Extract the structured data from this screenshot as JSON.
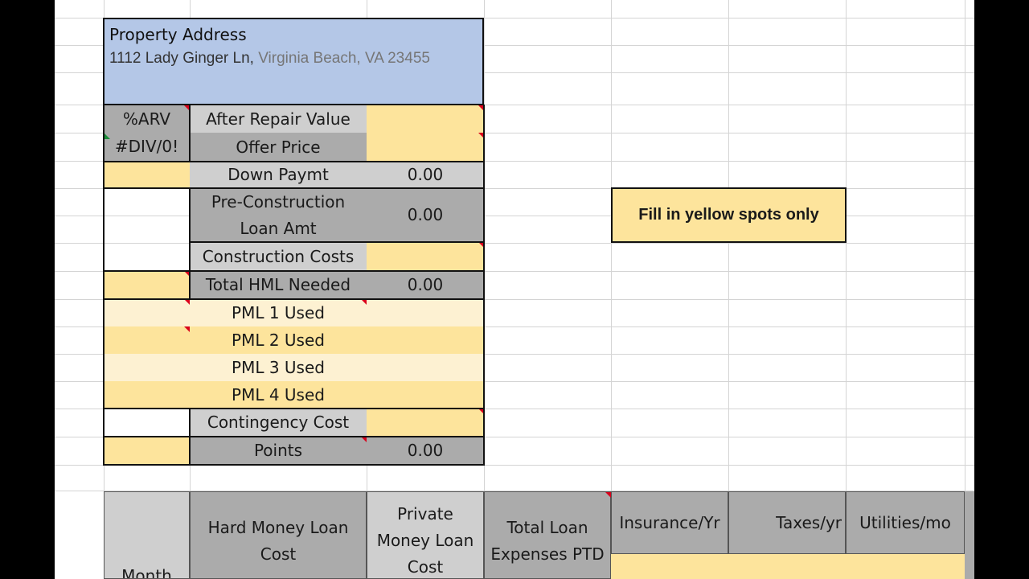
{
  "property": {
    "heading": "Property Address",
    "street": "1112 Lady Ginger Ln,",
    "city": "Virginia Beach, VA 23455"
  },
  "arv": {
    "label": "%ARV",
    "value": "#DIV/0!"
  },
  "rows": {
    "after_repair_value": "After Repair Value",
    "offer_price": "Offer Price",
    "down_paymt": {
      "label": "Down Paymt",
      "value": "0.00"
    },
    "pre_construction": {
      "line1": "Pre-Construction",
      "line2": "Loan Amt",
      "value": "0.00"
    },
    "construction_costs": "Construction Costs",
    "total_hml": {
      "label": "Total HML Needed",
      "value": "0.00"
    },
    "pml1": "PML 1 Used",
    "pml2": "PML 2 Used",
    "pml3": "PML 3 Used",
    "pml4": "PML 4 Used",
    "contingency": "Contingency Cost",
    "points": {
      "label": "Points",
      "value": "0.00"
    }
  },
  "note": "Fill in yellow spots only",
  "table_headers": {
    "month": "Month",
    "hml_line1": "Hard Money Loan",
    "hml_line2": "Cost",
    "pml_line1": "Private",
    "pml_line2": "Money Loan",
    "pml_line3": "Cost",
    "tle_line1": "Total Loan",
    "tle_line2": "Expenses PTD",
    "insurance": "Insurance/Yr",
    "taxes": "Taxes/yr",
    "utilities": "Utilities/mo"
  }
}
